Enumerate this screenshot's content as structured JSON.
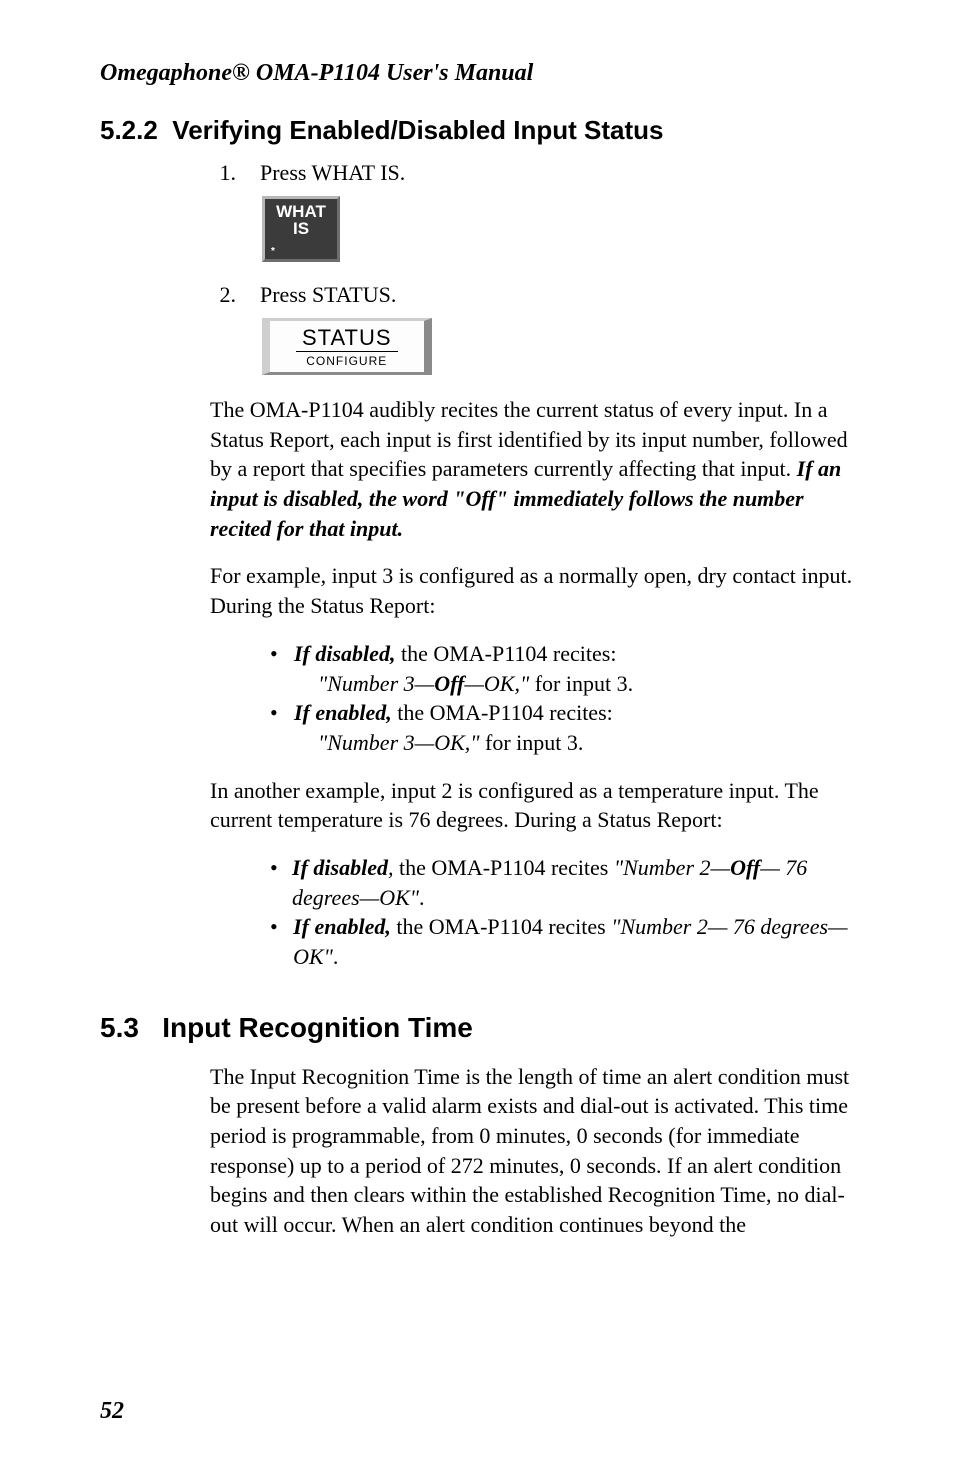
{
  "header": "Omegaphone® OMA-P1104 User's Manual",
  "sec522": {
    "num": "5.2.2",
    "title": "Verifying Enabled/Disabled Input Status",
    "step1_num": "1.",
    "step1_text": "Press WHAT IS.",
    "key_whatis_l1": "WHAT",
    "key_whatis_l2": "IS",
    "key_whatis_star": "*",
    "step2_num": "2.",
    "step2_text": "Press STATUS.",
    "key_status_top": "STATUS",
    "key_status_bot": "CONFIGURE",
    "p1_a": "The OMA-P1104 audibly recites the current status of every input. In a Status Report, each input is first identified by its input number, followed by a report that specifies parameters currently affecting that input. ",
    "p1_b": "If an input is disabled, the word \"Off\" immediately follows the number recited for that input.",
    "p2": "For example, input 3 is configured as a normally open, dry contact input. During the Status Report:",
    "b1_label": "If disabled,",
    "b1_text": " the OMA-P1104 recites:",
    "b1_sub_pre": "\"Number 3—",
    "b1_sub_off": "Off",
    "b1_sub_post": "—OK,\"",
    "b1_sub_tail": " for input 3.",
    "b2_label": "If enabled,",
    "b2_text": " the OMA-P1104 recites:",
    "b2_sub_quote": "\"Number 3—OK,\"",
    "b2_sub_tail": " for input 3.",
    "p3": "In another example, input 2 is configured as a temperature input. The current temperature is 76 degrees. During a Status Report:",
    "b3_label": "If disabled",
    "b3_comma": ", ",
    "b3_text": "the OMA-P1104 recites ",
    "b3_quote_pre": "\"Number 2—",
    "b3_quote_off": "Off",
    "b3_quote_post": "— 76 degrees—OK\"",
    "b3_period": ".",
    "b4_label": "If enabled,",
    "b4_text": " the OMA-P1104 recites ",
    "b4_quote": "\"Number 2— 76 degrees—OK\"",
    "b4_period": "."
  },
  "sec53": {
    "num": "5.3",
    "title": "Input Recognition Time",
    "p1": "The Input Recognition Time is the length of time an alert condition must be present before a valid alarm exists and dial-out is activated. This time period is programmable, from 0 minutes, 0 seconds (for immediate response) up to a period of 272 minutes, 0 seconds. If an alert condition begins and then clears within the established Recognition Time, no dial-out will occur. When an alert condition continues beyond the"
  },
  "page_number": "52"
}
